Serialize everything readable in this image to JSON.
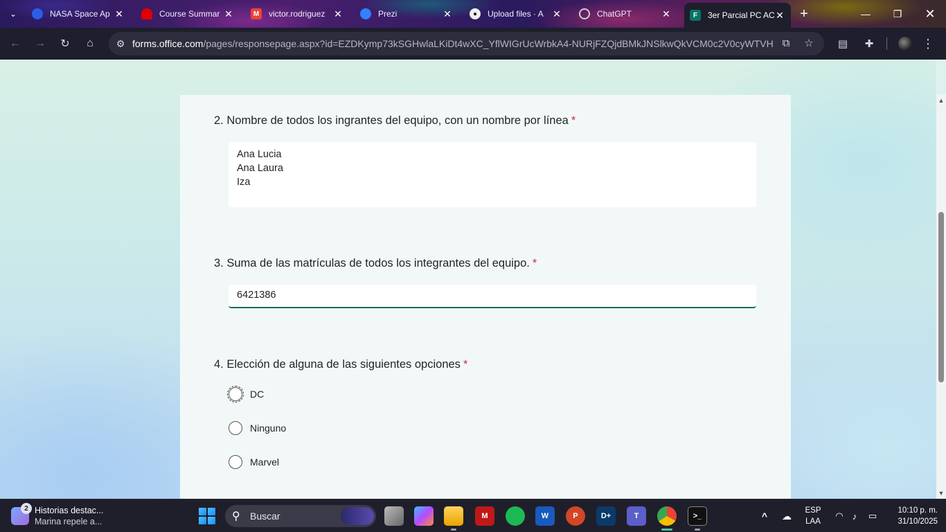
{
  "browser": {
    "tabs": [
      {
        "title": "NASA Space Ap",
        "icon": "nasa-icon",
        "color": "#2b5ee8"
      },
      {
        "title": "Course Summar",
        "icon": "redhat-icon",
        "color": "#e00000"
      },
      {
        "title": "victor.rodriguez",
        "icon": "gmail-icon",
        "color": "#ea4335"
      },
      {
        "title": "Prezi",
        "icon": "prezi-icon",
        "color": "#3181ff"
      },
      {
        "title": "Upload files · A",
        "icon": "github-icon",
        "color": "#f0f0f0"
      },
      {
        "title": "ChatGPT",
        "icon": "chatgpt-icon",
        "color": "#cfcfcf"
      },
      {
        "title": "3er Parcial PC AC",
        "icon": "forms-icon",
        "color": "#077568"
      }
    ],
    "url_domain": "forms.office.com",
    "url_path": "/pages/responsepage.aspx?id=EZDKymp73kSGHwlaLKiDt4wXC_YflWIGrUcWrbkA4-NURjFZQjdBMkJNSlkwQkVCM0c2V0cyWTVHNS..."
  },
  "form": {
    "q2": {
      "number": "2.",
      "title": "Nombre de todos los ingrantes del equipo, con un nombre por línea",
      "required_mark": "*",
      "answer_lines": [
        "Ana Lucia",
        "Ana Laura",
        "Iza"
      ]
    },
    "q3": {
      "number": "3.",
      "title": "Suma de las matrículas de todos los integrantes del equipo.",
      "required_mark": "*",
      "answer": "6421386"
    },
    "q4": {
      "number": "4.",
      "title": "Elección de alguna de las siguientes opciones",
      "required_mark": "*",
      "options": [
        "DC",
        "Ninguno",
        "Marvel"
      ]
    }
  },
  "taskbar": {
    "news_badge": "2",
    "news_title": "Historias destac...",
    "news_subtitle": "Marina repele a...",
    "search_label": "Buscar",
    "lang_top": "ESP",
    "lang_bottom": "LAA",
    "time": "10:10 p. m.",
    "date": "31/10/2025"
  }
}
